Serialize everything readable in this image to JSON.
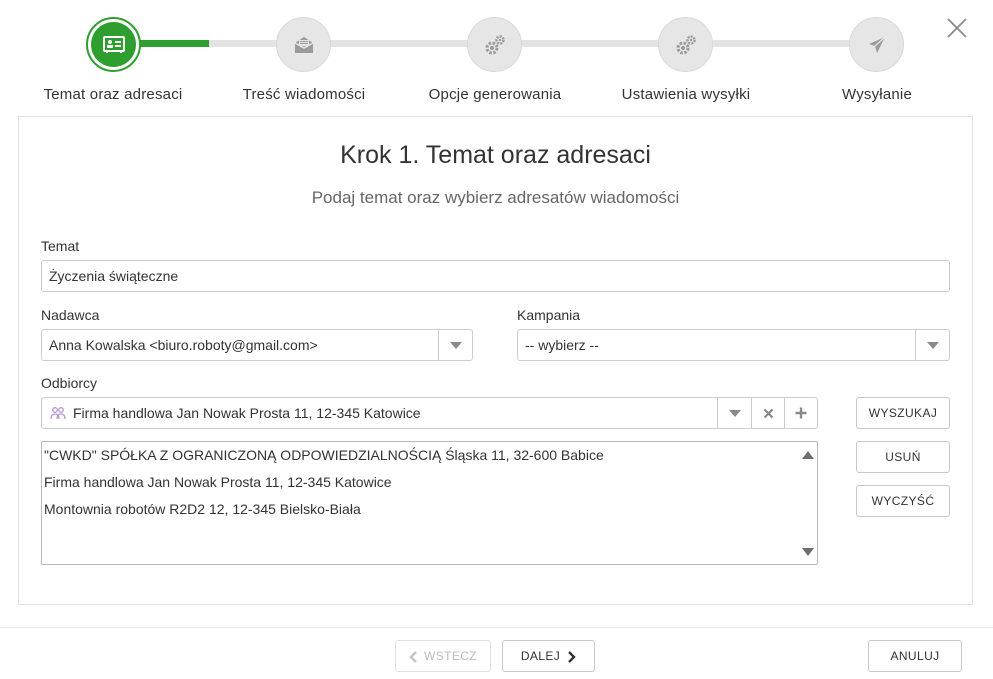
{
  "wizard": {
    "steps": [
      {
        "label": "Temat oraz adresaci",
        "icon": "contact-card-icon",
        "active": true
      },
      {
        "label": "Treść wiadomości",
        "icon": "envelope-icon",
        "active": false
      },
      {
        "label": "Opcje generowania",
        "icon": "gears-icon",
        "active": false
      },
      {
        "label": "Ustawienia wysyłki",
        "icon": "gears-icon",
        "active": false
      },
      {
        "label": "Wysyłanie",
        "icon": "paper-plane-icon",
        "active": false
      }
    ],
    "progress_fraction": 0.345
  },
  "panel": {
    "title": "Krok 1. Temat oraz adresaci",
    "subtitle": "Podaj temat oraz wybierz adresatów wiadomości"
  },
  "form": {
    "subject_label": "Temat",
    "subject_value": "Życzenia świąteczne",
    "sender_label": "Nadawca",
    "sender_value": "Anna Kowalska <biuro.roboty@gmail.com>",
    "campaign_label": "Kampania",
    "campaign_value": "-- wybierz --",
    "recipients_label": "Odbiorcy",
    "recipient_selected": "Firma handlowa Jan Nowak Prosta 11, 12-345 Katowice",
    "recipients_list": [
      "\"CWKD\" SPÓŁKA Z OGRANICZONĄ ODPOWIEDZIALNOŚCIĄ Śląska 11, 32-600 Babice",
      "Firma handlowa Jan Nowak Prosta 11, 12-345 Katowice",
      "Montownia robotów R2D2 12, 12-345 Bielsko-Biała"
    ]
  },
  "buttons": {
    "search": "WYSZUKAJ",
    "remove": "USUŃ",
    "clear": "WYCZYŚĆ",
    "back": "WSTECZ",
    "next": "DALEJ",
    "cancel": "ANULUJ"
  },
  "colors": {
    "accent": "#2e9e2e",
    "inactive_step": "#e6e6e6",
    "recipient_icon": "#b89ad6"
  }
}
